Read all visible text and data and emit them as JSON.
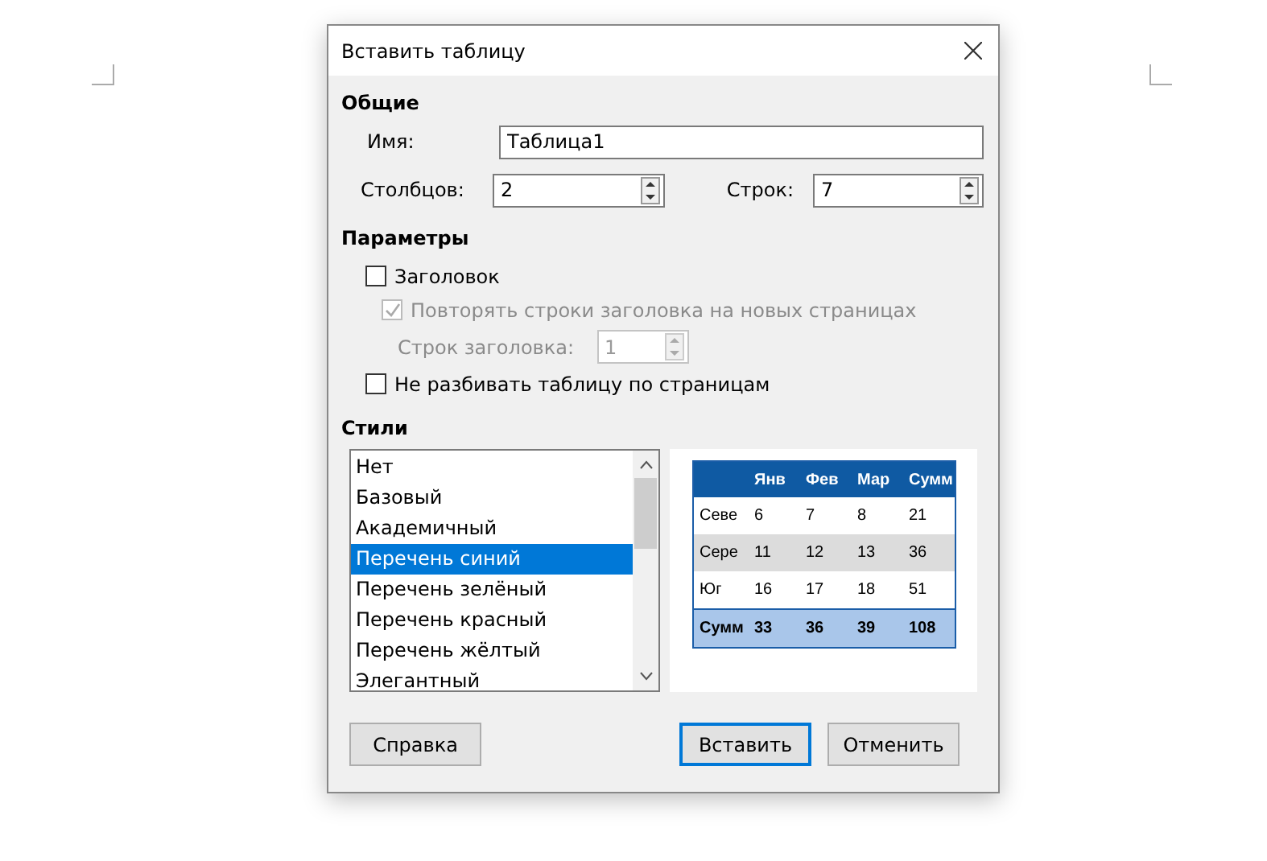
{
  "window": {
    "title": "Вставить таблицу"
  },
  "general": {
    "heading": "Общие",
    "name_label": "Имя:",
    "name_value": "Таблица1",
    "columns_label": "Столбцов:",
    "columns_value": "2",
    "rows_label": "Строк:",
    "rows_value": "7"
  },
  "options": {
    "heading": "Параметры",
    "items": [
      {
        "kind": "checkbox",
        "label": "Заголовок",
        "checked": false,
        "disabled": false
      },
      {
        "kind": "checkbox",
        "label": "Повторять строки заголовка на новых страницах",
        "checked": true,
        "disabled": true
      },
      {
        "kind": "spin",
        "label": "Строк заголовка:",
        "value": "1",
        "disabled": true
      },
      {
        "kind": "checkbox",
        "label": "Не разбивать таблицу по страницам",
        "checked": false,
        "disabled": false
      }
    ]
  },
  "styles": {
    "heading": "Стили",
    "items": [
      {
        "label": "Нет",
        "selected": false
      },
      {
        "label": "Базовый",
        "selected": false
      },
      {
        "label": "Академичный",
        "selected": false
      },
      {
        "label": "Перечень синий",
        "selected": true
      },
      {
        "label": "Перечень зелёный",
        "selected": false
      },
      {
        "label": "Перечень красный",
        "selected": false
      },
      {
        "label": "Перечень жёлтый",
        "selected": false
      },
      {
        "label": "Элегантный",
        "selected": false
      }
    ]
  },
  "preview": {
    "rows": [
      {
        "kind": "header",
        "cells": [
          "",
          "Янв",
          "Фев",
          "Мар",
          "Сумм"
        ]
      },
      {
        "kind": "plain",
        "cells": [
          "Севе",
          "6",
          "7",
          "8",
          "21"
        ]
      },
      {
        "kind": "shaded",
        "cells": [
          "Сере",
          "11",
          "12",
          "13",
          "36"
        ]
      },
      {
        "kind": "plain",
        "cells": [
          "Юг",
          "16",
          "17",
          "18",
          "51"
        ]
      },
      {
        "kind": "total",
        "cells": [
          "Сумм",
          "33",
          "36",
          "39",
          "108"
        ]
      }
    ]
  },
  "buttons": [
    {
      "label": "Справка",
      "kind": "help"
    },
    {
      "label": "Вставить",
      "kind": "default"
    },
    {
      "label": "Отменить",
      "kind": "normal"
    }
  ]
}
